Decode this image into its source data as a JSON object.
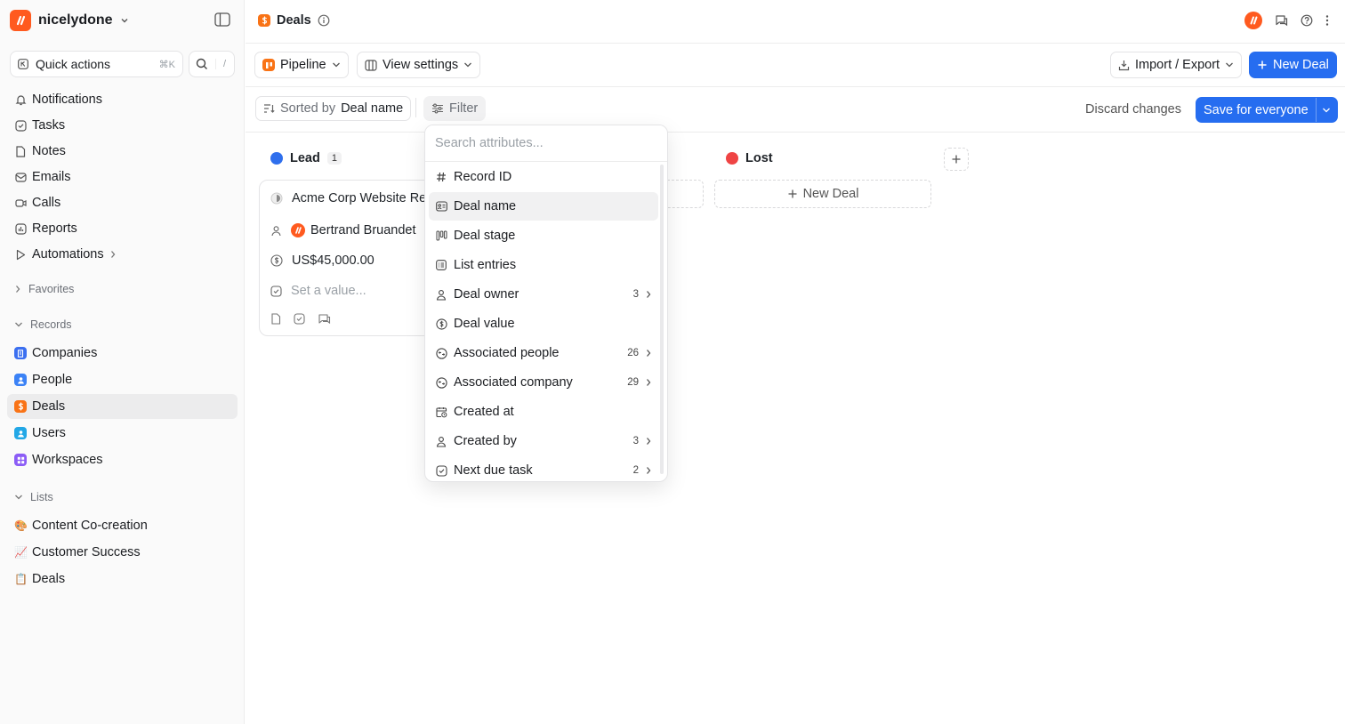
{
  "workspace": {
    "name": "nicelydone"
  },
  "sidebar": {
    "quick_actions": {
      "label": "Quick actions",
      "shortcut": "⌘K"
    },
    "search_shortcut": "/",
    "nav": [
      {
        "label": "Notifications",
        "icon": "bell-icon"
      },
      {
        "label": "Tasks",
        "icon": "check-square-icon"
      },
      {
        "label": "Notes",
        "icon": "file-icon"
      },
      {
        "label": "Emails",
        "icon": "mail-icon"
      },
      {
        "label": "Calls",
        "icon": "video-icon"
      },
      {
        "label": "Reports",
        "icon": "chart-icon"
      },
      {
        "label": "Automations",
        "icon": "play-icon"
      }
    ],
    "favorites_label": "Favorites",
    "records_label": "Records",
    "records": [
      {
        "label": "Companies",
        "color": "#3b6ff0"
      },
      {
        "label": "People",
        "color": "#3b82f6"
      },
      {
        "label": "Deals",
        "color": "#f97316"
      },
      {
        "label": "Users",
        "color": "#22a7e6"
      },
      {
        "label": "Workspaces",
        "color": "#8b5cf6"
      }
    ],
    "lists_label": "Lists",
    "lists": [
      {
        "label": "Content Co-creation",
        "emoji": "🎨"
      },
      {
        "label": "Customer Success",
        "emoji": "📈"
      },
      {
        "label": "Deals",
        "emoji": "📋"
      }
    ]
  },
  "header": {
    "title": "Deals"
  },
  "toolbar": {
    "view": "Pipeline",
    "view_settings": "View settings",
    "import_export": "Import / Export",
    "new_deal": "New Deal"
  },
  "filterbar": {
    "sorted_by": "Sorted by",
    "sort_field": "Deal name",
    "filter": "Filter",
    "discard": "Discard changes",
    "save": "Save for everyone"
  },
  "board": {
    "columns": [
      {
        "name": "Lead",
        "count": "1",
        "color": "#2f6fed"
      },
      {
        "name": "Lost",
        "color": "#ef4444"
      }
    ],
    "card": {
      "title": "Acme Corp Website Re",
      "owner": "Bertrand Bruandet",
      "value": "US$45,000.00",
      "placeholder": "Set a value..."
    },
    "new_deal": "New Deal"
  },
  "filter_dropdown": {
    "search_placeholder": "Search attributes...",
    "items": [
      {
        "label": "Record ID",
        "icon": "hash-icon",
        "count": ""
      },
      {
        "label": "Deal name",
        "icon": "text-icon",
        "count": ""
      },
      {
        "label": "Deal stage",
        "icon": "kanban-icon",
        "count": ""
      },
      {
        "label": "List entries",
        "icon": "list-icon",
        "count": ""
      },
      {
        "label": "Deal owner",
        "icon": "user-icon",
        "count": "3"
      },
      {
        "label": "Deal value",
        "icon": "dollar-icon",
        "count": ""
      },
      {
        "label": "Associated people",
        "icon": "relation-icon",
        "count": "26"
      },
      {
        "label": "Associated company",
        "icon": "relation-icon",
        "count": "29"
      },
      {
        "label": "Created at",
        "icon": "calendar-clock-icon",
        "count": ""
      },
      {
        "label": "Created by",
        "icon": "user-icon",
        "count": "3"
      },
      {
        "label": "Next due task",
        "icon": "check-square-icon",
        "count": "2"
      }
    ]
  }
}
